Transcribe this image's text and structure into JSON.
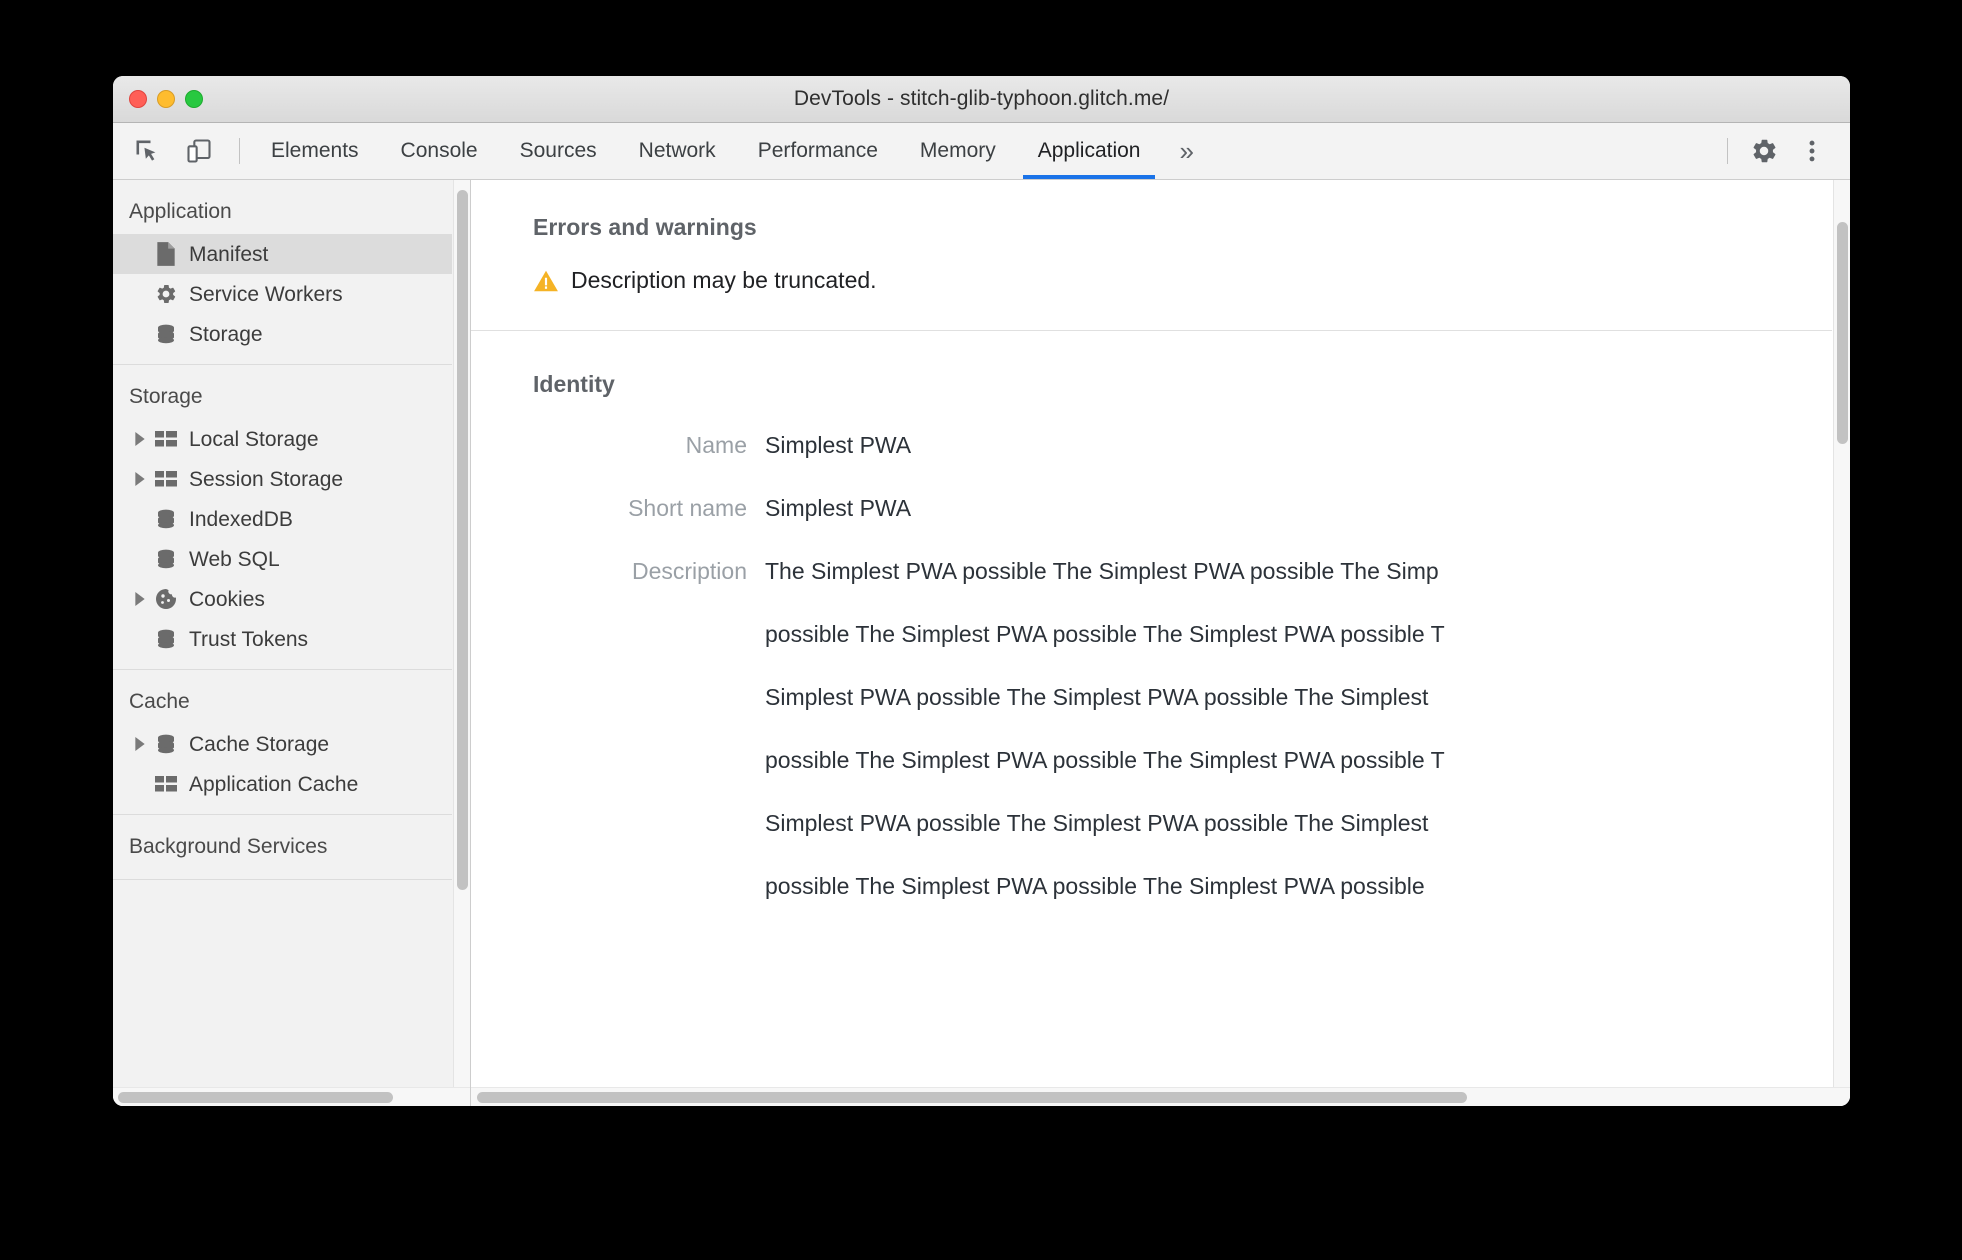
{
  "window": {
    "title": "DevTools - stitch-glib-typhoon.glitch.me/",
    "traffic_lights": [
      "close",
      "minimize",
      "zoom"
    ]
  },
  "colors": {
    "accent": "#1a73e8",
    "warning": "#f5b325",
    "sidebar_bg": "#f2f2f2",
    "selected_row": "#dcdcdc",
    "label_text": "#9aa0a6",
    "value_text": "#2c3239"
  },
  "toolbar": {
    "inspect_icon": "inspect-element-icon",
    "device_icon": "device-toolbar-icon",
    "overflow_label": "»",
    "settings_icon": "gear-icon",
    "more_icon": "more-vertical-icon"
  },
  "tabs": [
    {
      "label": "Elements",
      "active": false
    },
    {
      "label": "Console",
      "active": false
    },
    {
      "label": "Sources",
      "active": false
    },
    {
      "label": "Network",
      "active": false
    },
    {
      "label": "Performance",
      "active": false
    },
    {
      "label": "Memory",
      "active": false
    },
    {
      "label": "Application",
      "active": true
    }
  ],
  "sidebar": {
    "groups": [
      {
        "title": "Application",
        "items": [
          {
            "label": "Manifest",
            "icon": "document-icon",
            "selected": true,
            "expandable": false
          },
          {
            "label": "Service Workers",
            "icon": "gear-icon",
            "selected": false,
            "expandable": false
          },
          {
            "label": "Storage",
            "icon": "database-icon",
            "selected": false,
            "expandable": false
          }
        ]
      },
      {
        "title": "Storage",
        "items": [
          {
            "label": "Local Storage",
            "icon": "table-icon",
            "selected": false,
            "expandable": true
          },
          {
            "label": "Session Storage",
            "icon": "table-icon",
            "selected": false,
            "expandable": true
          },
          {
            "label": "IndexedDB",
            "icon": "database-icon",
            "selected": false,
            "expandable": false
          },
          {
            "label": "Web SQL",
            "icon": "database-icon",
            "selected": false,
            "expandable": false
          },
          {
            "label": "Cookies",
            "icon": "cookie-icon",
            "selected": false,
            "expandable": true
          },
          {
            "label": "Trust Tokens",
            "icon": "database-icon",
            "selected": false,
            "expandable": false
          }
        ]
      },
      {
        "title": "Cache",
        "items": [
          {
            "label": "Cache Storage",
            "icon": "database-icon",
            "selected": false,
            "expandable": true
          },
          {
            "label": "Application Cache",
            "icon": "table-icon",
            "selected": false,
            "expandable": false
          }
        ]
      },
      {
        "title": "Background Services",
        "items": []
      }
    ]
  },
  "main": {
    "errors_section": {
      "title": "Errors and warnings",
      "warnings": [
        {
          "icon": "warning-triangle-icon",
          "text": "Description may be truncated."
        }
      ]
    },
    "identity_section": {
      "title": "Identity",
      "fields": [
        {
          "label": "Name",
          "value": "Simplest PWA"
        },
        {
          "label": "Short name",
          "value": "Simplest PWA"
        }
      ],
      "description_label": "Description",
      "description_lines": [
        "The Simplest PWA possible The Simplest PWA possible The Simp",
        "possible The Simplest PWA possible The Simplest PWA possible T",
        "Simplest PWA possible The Simplest PWA possible The Simplest",
        "possible The Simplest PWA possible The Simplest PWA possible T",
        "Simplest PWA possible The Simplest PWA possible The Simplest",
        "possible The Simplest PWA possible The Simplest PWA possible"
      ]
    }
  }
}
